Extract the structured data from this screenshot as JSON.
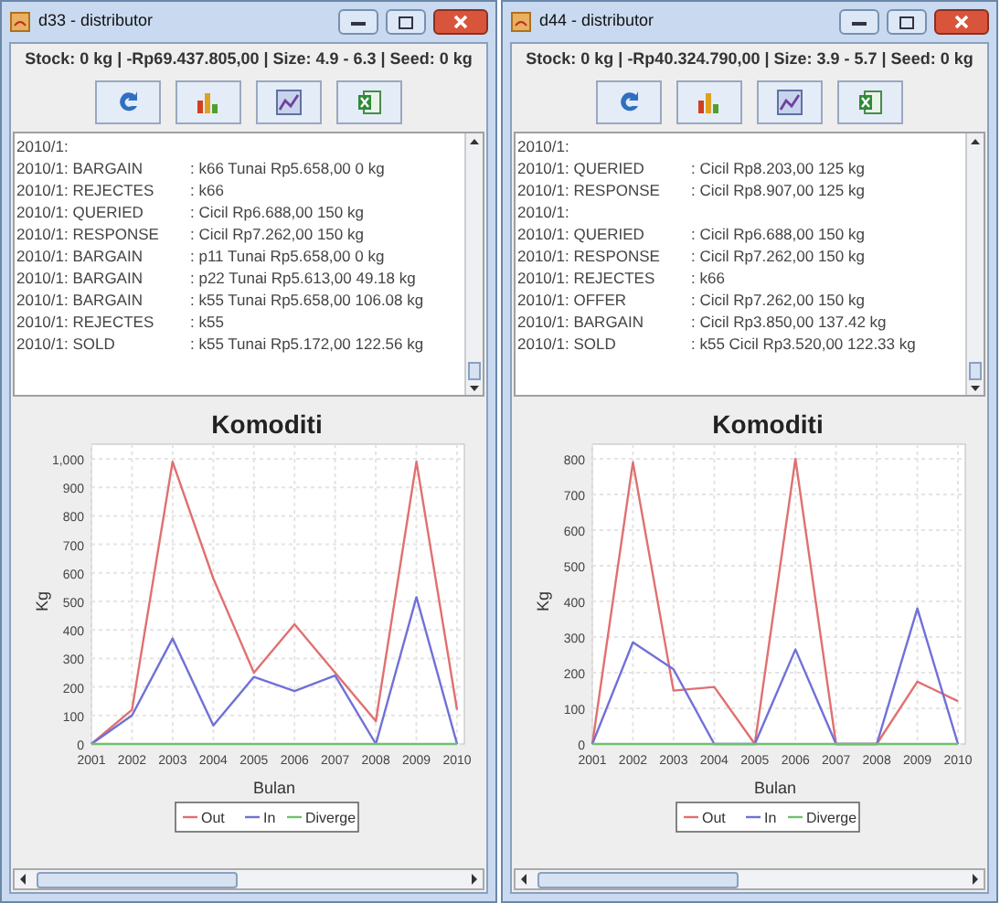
{
  "windows": [
    {
      "title": "d33 - distributor",
      "status": "Stock: 0 kg | -Rp69.437.805,00 | Size: 4.9 - 6.3 | Seed: 0 kg",
      "log": [
        {
          "key": "2010/1:"
        },
        {
          "key": "2010/1: BARGAIN",
          "value": ": k66 Tunai Rp5.658,00 0 kg"
        },
        {
          "key": "2010/1: REJECTES",
          "value": ": k66"
        },
        {
          "key": "2010/1: QUERIED",
          "value": ": Cicil Rp6.688,00 150 kg"
        },
        {
          "key": "2010/1: RESPONSE",
          "value": ": Cicil Rp7.262,00 150 kg"
        },
        {
          "key": "2010/1: BARGAIN",
          "value": ": p11 Tunai Rp5.658,00 0 kg"
        },
        {
          "key": "2010/1: BARGAIN",
          "value": ": p22 Tunai Rp5.613,00 49.18 kg"
        },
        {
          "key": "2010/1: BARGAIN",
          "value": ": k55 Tunai Rp5.658,00 106.08 kg"
        },
        {
          "key": "2010/1: REJECTES",
          "value": ": k55"
        },
        {
          "key": "2010/1: SOLD",
          "value": ": k55 Tunai Rp5.172,00 122.56 kg"
        }
      ],
      "chart_data": {
        "type": "line",
        "title": "Komoditi",
        "xlabel": "Bulan",
        "ylabel": "Kg",
        "categories": [
          "2001",
          "2002",
          "2003",
          "2004",
          "2005",
          "2006",
          "2007",
          "2008",
          "2009",
          "2010"
        ],
        "series": [
          {
            "name": "Out",
            "color": "#e07070",
            "values": [
              0,
              120,
              990,
              580,
              250,
              420,
              250,
              80,
              990,
              120
            ]
          },
          {
            "name": "In",
            "color": "#7070d8",
            "values": [
              0,
              100,
              370,
              65,
              235,
              185,
              240,
              0,
              515,
              0
            ]
          },
          {
            "name": "Diverge",
            "color": "#70c070",
            "values": [
              0,
              0,
              0,
              0,
              0,
              0,
              0,
              0,
              0,
              0
            ]
          }
        ],
        "ylim": [
          0,
          1000
        ],
        "grid": true,
        "legend": true,
        "yticks": [
          0,
          100,
          200,
          300,
          400,
          500,
          600,
          700,
          800,
          900,
          {
            "value": 1000,
            "label": "1,000"
          }
        ]
      }
    },
    {
      "title": "d44 - distributor",
      "status": "Stock: 0 kg | -Rp40.324.790,00 | Size: 3.9 - 5.7 | Seed: 0 kg",
      "log": [
        {
          "key": "2010/1:"
        },
        {
          "key": "2010/1: QUERIED",
          "value": ": Cicil Rp8.203,00 125 kg"
        },
        {
          "key": "2010/1: RESPONSE",
          "value": ": Cicil Rp8.907,00 125 kg"
        },
        {
          "key": "2010/1:"
        },
        {
          "key": "2010/1: QUERIED",
          "value": ": Cicil Rp6.688,00 150 kg"
        },
        {
          "key": "2010/1: RESPONSE",
          "value": ": Cicil Rp7.262,00 150 kg"
        },
        {
          "key": "2010/1: REJECTES",
          "value": ": k66"
        },
        {
          "key": "2010/1: OFFER",
          "value": ": Cicil Rp7.262,00 150 kg"
        },
        {
          "key": "2010/1: BARGAIN",
          "value": ": Cicil Rp3.850,00 137.42 kg"
        },
        {
          "key": "2010/1: SOLD",
          "value": ": k55 Cicil Rp3.520,00 122.33 kg"
        }
      ],
      "chart_data": {
        "type": "line",
        "title": "Komoditi",
        "xlabel": "Bulan",
        "ylabel": "Kg",
        "categories": [
          "2001",
          "2002",
          "2003",
          "2004",
          "2005",
          "2006",
          "2007",
          "2008",
          "2009",
          "2010"
        ],
        "series": [
          {
            "name": "Out",
            "color": "#e07070",
            "values": [
              0,
              790,
              150,
              160,
              0,
              800,
              0,
              0,
              175,
              120
            ]
          },
          {
            "name": "In",
            "color": "#7070d8",
            "values": [
              0,
              285,
              210,
              0,
              0,
              265,
              0,
              0,
              380,
              0
            ]
          },
          {
            "name": "Diverge",
            "color": "#70c070",
            "values": [
              0,
              0,
              0,
              0,
              0,
              0,
              0,
              0,
              0,
              0
            ]
          }
        ],
        "ylim": [
          0,
          800
        ],
        "grid": true,
        "legend": true,
        "yticks": [
          0,
          100,
          200,
          300,
          400,
          500,
          600,
          700,
          800
        ]
      }
    }
  ]
}
